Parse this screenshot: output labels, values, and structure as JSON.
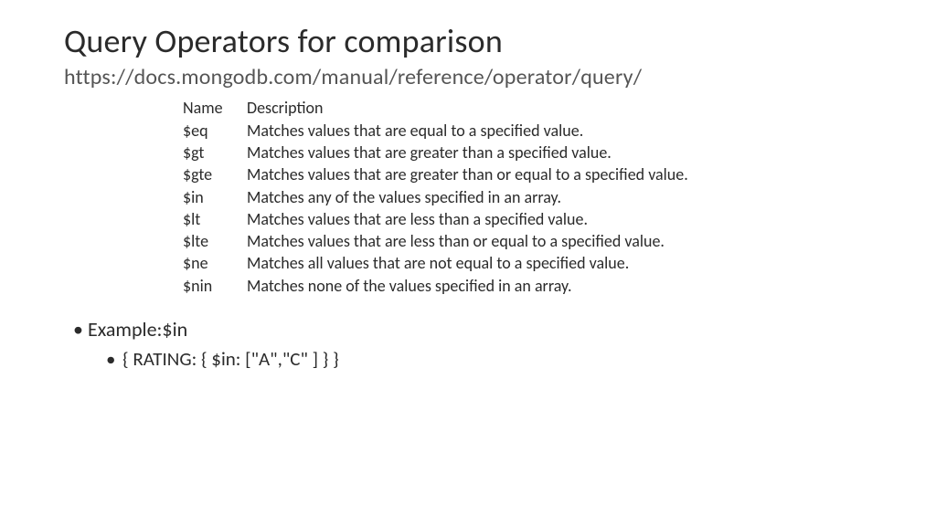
{
  "title": "Query Operators for comparison",
  "subtitle": "https://docs.mongodb.com/manual/reference/operator/query/",
  "header": {
    "name": "Name",
    "description": "Description"
  },
  "operators": [
    {
      "name": "$eq",
      "description": "Matches values that are equal to a specified value."
    },
    {
      "name": "$gt",
      "description": "Matches values that are greater than a specified value."
    },
    {
      "name": "$gte",
      "description": "Matches values that are greater than or equal to a specified value."
    },
    {
      "name": "$in",
      "description": "Matches any of the values specified in an array."
    },
    {
      "name": "$lt",
      "description": "Matches values that are less than a specified value."
    },
    {
      "name": "$lte",
      "description": "Matches values that are less than or equal to a specified value."
    },
    {
      "name": "$ne",
      "description": "Matches all values that are not equal to a specified value."
    },
    {
      "name": "$nin",
      "description": "Matches none of the values specified in an array."
    }
  ],
  "example": {
    "label": "Example:$in",
    "code": "{ RATING: { $in: [\"A\",\"C\" ] } }"
  }
}
